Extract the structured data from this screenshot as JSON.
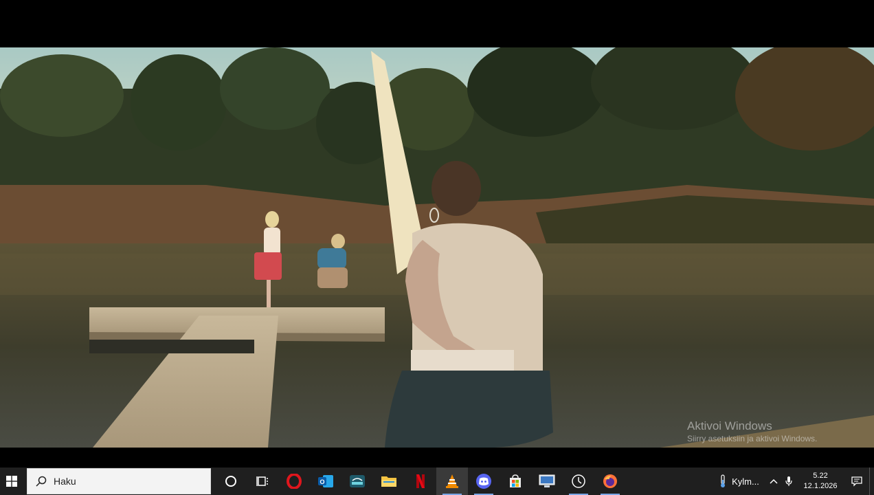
{
  "watermark": {
    "title": "Aktivoi Windows",
    "subtitle": "Siirry asetuksiin ja aktivoi Windows."
  },
  "taskbar": {
    "search_placeholder": "Haku",
    "pinned": [
      {
        "name": "task-view-circle",
        "icon": "circle-icon"
      },
      {
        "name": "task-view",
        "icon": "task-view-icon"
      },
      {
        "name": "opera",
        "icon": "opera-icon"
      },
      {
        "name": "outlook",
        "icon": "outlook-icon"
      },
      {
        "name": "disney-plus",
        "icon": "disney-plus-icon"
      },
      {
        "name": "file-explorer",
        "icon": "folder-icon"
      },
      {
        "name": "netflix",
        "icon": "netflix-icon"
      },
      {
        "name": "vlc",
        "icon": "vlc-cone-icon"
      },
      {
        "name": "discord",
        "icon": "discord-icon"
      },
      {
        "name": "microsoft-store",
        "icon": "store-icon"
      },
      {
        "name": "remote-desktop",
        "icon": "monitor-icon"
      },
      {
        "name": "clock-app",
        "icon": "clock-icon"
      },
      {
        "name": "firefox",
        "icon": "firefox-icon"
      }
    ],
    "weather_label": "Kylm...",
    "time": "5.22",
    "date": "12.1.2026"
  }
}
